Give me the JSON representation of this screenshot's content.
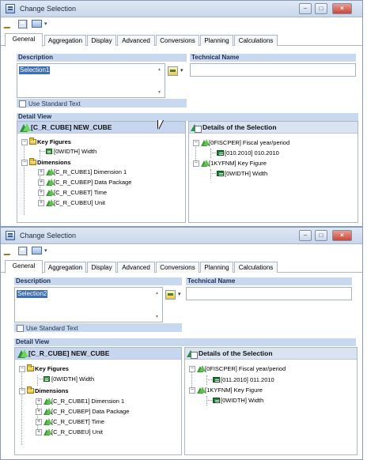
{
  "window_title": "Change Selection",
  "window_controls": {
    "minimize": "–",
    "maximize": "□",
    "close": "×"
  },
  "tabs": [
    "General",
    "Aggregation",
    "Display",
    "Advanced",
    "Conversions",
    "Planning",
    "Calculations"
  ],
  "labels": {
    "description": "Description",
    "technical_name": "Technical Name",
    "use_standard_text": "Use Standard Text",
    "detail_view": "Detail View",
    "details": "Details of the Selection"
  },
  "icons": {
    "edit": "pencil-icon",
    "save": "save-icon",
    "filter": "filter-icon",
    "folder": "folder-icon",
    "dimension": "hierarchy-icon",
    "key_figure": "key-figure-icon"
  },
  "colors": {
    "title_bar": "#c9d7ea",
    "section_label": "#c8d8ef",
    "selection": "#3d6fb1",
    "green_icon": "#2b9440"
  },
  "dialogs": [
    {
      "description_value": "Selection1",
      "technical_name_value": "",
      "cube_title": "[C_R_CUBE] NEW_CUBE",
      "left_tree": {
        "key_figures": "Key Figures",
        "key_figure_width": "[0WIDTH] Width",
        "dimensions": "Dimensions",
        "dimension_items": [
          "[C_R_CUBE1] Dimension 1",
          "[C_R_CUBEP] Data Package",
          "[C_R_CUBET] Time",
          "[C_R_CUBEU] Unit"
        ]
      },
      "right_tree": {
        "fiscal_period": "[0FISCPER] Fiscal year/period",
        "period_value": "[010.2010] 010.2010",
        "key_figure": "[1KYFNM] Key Figure",
        "width_value": "[0WIDTH] Width"
      }
    },
    {
      "description_value": "Selection2",
      "technical_name_value": "",
      "cube_title": "[C_R_CUBE] NEW_CUBE",
      "left_tree": {
        "key_figures": "Key Figures",
        "key_figure_width": "[0WIDTH] Width",
        "dimensions": "Dimensions",
        "dimension_items": [
          "[C_R_CUBE1] Dimension 1",
          "[C_R_CUBEP] Data Package",
          "[C_R_CUBET] Time",
          "[C_R_CUBEU] Unit"
        ]
      },
      "right_tree": {
        "fiscal_period": "[0FISCPER] Fiscal year/period",
        "period_value": "[011.2010] 011.2010",
        "key_figure": "[1KYFNM] Key Figure",
        "width_value": "[0WIDTH] Width"
      }
    }
  ]
}
